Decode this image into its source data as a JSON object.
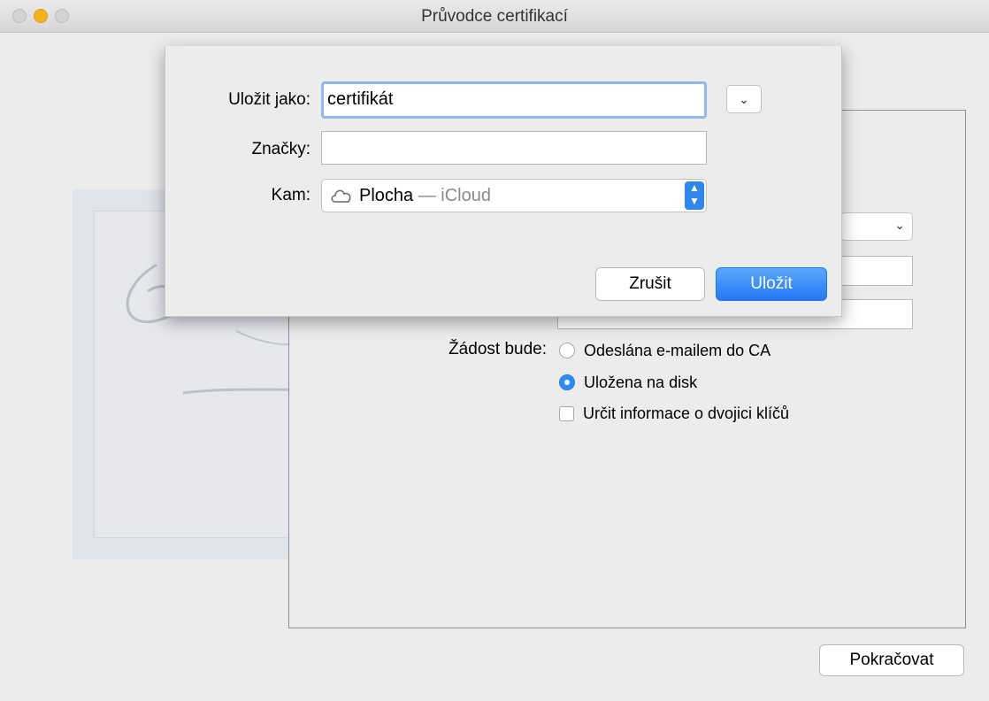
{
  "window": {
    "title": "Průvodce certifikací"
  },
  "wizard": {
    "request_label": "Žádost bude:",
    "options": [
      {
        "label": "Odeslána e-mailem do CA",
        "selected": false
      },
      {
        "label": "Uložena na disk",
        "selected": true
      }
    ],
    "checkbox": {
      "label": "Určit informace o dvojici klíčů",
      "checked": false
    },
    "continue_label": "Pokračovat"
  },
  "save_sheet": {
    "save_as_label": "Uložit jako:",
    "save_as_value": "certifikát",
    "tags_label": "Značky:",
    "tags_value": "",
    "where_label": "Kam:",
    "where_primary": "Plocha",
    "where_secondary": "— iCloud",
    "where_icon": "cloud-icon",
    "expand_icon": "chevron-down-icon",
    "cancel_label": "Zrušit",
    "save_label": "Uložit"
  },
  "colors": {
    "accent": "#2f86ec",
    "window_bg": "#ececec"
  }
}
